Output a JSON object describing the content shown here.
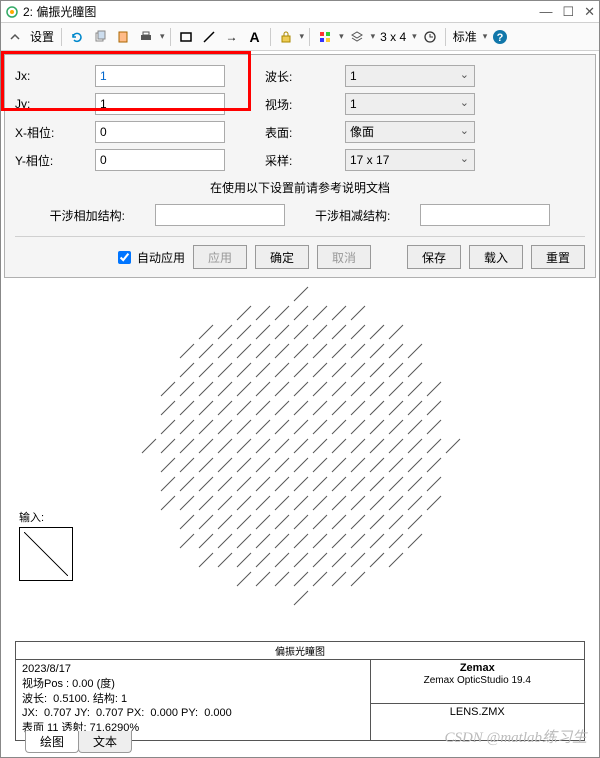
{
  "window": {
    "title": "2: 偏振光瞳图"
  },
  "toolbar": {
    "settings_label": "设置",
    "grid_label": "3 x 4",
    "standard_label": "标准"
  },
  "form": {
    "jx": {
      "label": "Jx:",
      "value": "1"
    },
    "jy": {
      "label": "Jy:",
      "value": "1"
    },
    "xphase": {
      "label": "X-相位:",
      "value": "0"
    },
    "yphase": {
      "label": "Y-相位:",
      "value": "0"
    },
    "wavelength": {
      "label": "波长:",
      "value": "1"
    },
    "field": {
      "label": "视场:",
      "value": "1"
    },
    "surface": {
      "label": "表面:",
      "value": "像面"
    },
    "sampling": {
      "label": "采样:",
      "value": "17 x 17"
    }
  },
  "note": "在使用以下设置前请参考说明文档",
  "struct": {
    "add_label": "干涉相加结构:",
    "add_value": "",
    "sub_label": "干涉相减结构:",
    "sub_value": ""
  },
  "buttons": {
    "auto": "自动应用",
    "apply": "应用",
    "ok": "确定",
    "cancel": "取消",
    "save": "保存",
    "load": "载入",
    "reset": "重置"
  },
  "input_indicator": {
    "label": "输入:"
  },
  "info": {
    "header": "偏振光瞳图",
    "date": "2023/8/17",
    "l2": "视场Pos : 0.00 (度)",
    "l3": "波长:  0.5100. 结构: 1",
    "l4": "JX:  0.707 JY:  0.707 PX:  0.000 PY:  0.000",
    "l5": "表面 11 透射: 71.6290%",
    "product": "Zemax",
    "version": "Zemax OpticStudio 19.4",
    "file": "LENS.ZMX"
  },
  "tabs": {
    "plot": "绘图",
    "text": "文本"
  },
  "watermark": "CSDN @matlab练习生",
  "chart_data": {
    "type": "scatter",
    "title": "偏振光瞳图",
    "grid": "17x17 pupil sampling inside circular aperture",
    "mark": "short diagonal line segment at ~45° per sample point",
    "jx": 0.707,
    "jy": 0.707,
    "px": 0.0,
    "py": 0.0
  }
}
